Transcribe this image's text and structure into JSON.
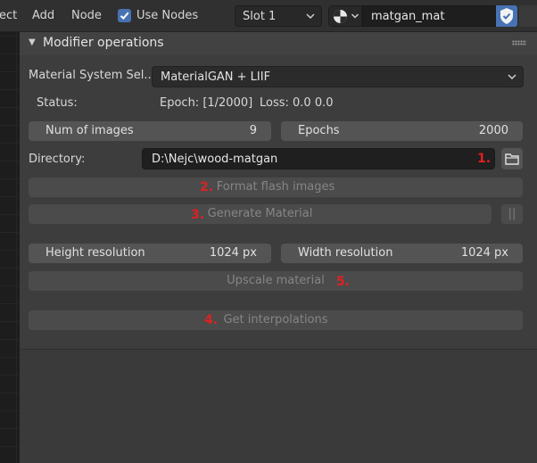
{
  "header": {
    "menu": [
      "ect",
      "Add",
      "Node"
    ],
    "use_nodes_label": "Use Nodes",
    "use_nodes_checked": true,
    "slot": "Slot 1",
    "material_name": "matgan_mat"
  },
  "panel": {
    "title": "Modifier operations",
    "material_system_label": "Material System Sel...",
    "material_system_value": "MaterialGAN + LIIF",
    "status_label": "Status:",
    "epoch_text": "Epoch: [1/2000]",
    "loss_text": "Loss: 0.0 0.0",
    "num_images_label": "Num of images",
    "num_images_value": "9",
    "epochs_label": "Epochs",
    "epochs_value": "2000",
    "directory_label": "Directory:",
    "directory_value": "D:\\Nejc\\wood-matgan",
    "format_flash_label": "Format flash images",
    "generate_material_label": "Generate Material",
    "pause_label": "||",
    "height_res_label": "Height resolution",
    "height_res_value": "1024 px",
    "width_res_label": "Width resolution",
    "width_res_value": "1024 px",
    "upscale_label": "Upscale material",
    "interpolations_label": "Get interpolations"
  },
  "annotations": {
    "a1": "1.",
    "a2": "2.",
    "a3": "3.",
    "a4": "4.",
    "a5": "5."
  },
  "colors": {
    "accent": "#4772b3",
    "annotation": "#e02020"
  },
  "icons": [
    "checkmark-icon",
    "chevron-down-icon",
    "material-ball-icon",
    "shield-icon",
    "folder-icon",
    "pause-icon",
    "collapse-triangle-icon",
    "grip-icon"
  ]
}
